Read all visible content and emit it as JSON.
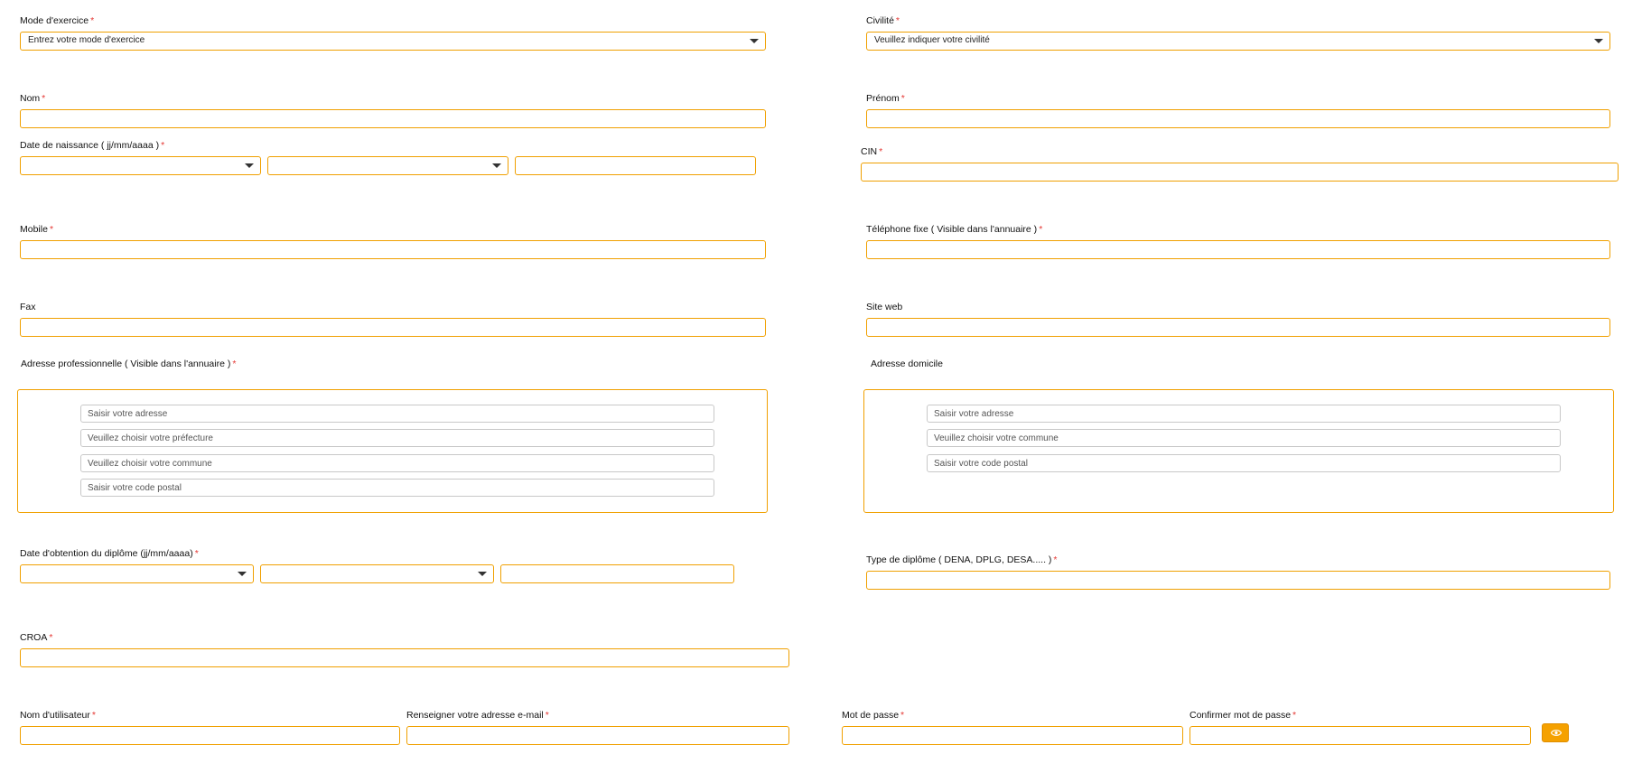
{
  "colors": {
    "accent": "#f0a000",
    "required": "#e53935",
    "button": "#f5a100"
  },
  "required_marker": "*",
  "mode_exercice": {
    "label": "Mode d'exercice",
    "value": "Entrez votre mode d'exercice"
  },
  "civilite": {
    "label": "Civilité",
    "value": "Veuillez indiquer votre civilité"
  },
  "nom": {
    "label": "Nom"
  },
  "prenom": {
    "label": "Prénom"
  },
  "date_naissance": {
    "label": "Date de naissance ( jj/mm/aaaa )"
  },
  "cin": {
    "label": "CIN"
  },
  "mobile": {
    "label": "Mobile"
  },
  "telephone_fixe": {
    "label": "Téléphone fixe ( Visible dans l'annuaire )"
  },
  "fax": {
    "label": "Fax"
  },
  "site_web": {
    "label": "Site web"
  },
  "adresse_pro": {
    "label": "Adresse professionnelle ( Visible dans l'annuaire )",
    "adresse_placeholder": "Saisir votre adresse",
    "prefecture_placeholder": "Veuillez choisir votre préfecture",
    "commune_placeholder": "Veuillez choisir votre commune",
    "code_postal_placeholder": "Saisir votre code postal"
  },
  "adresse_domicile": {
    "label": "Adresse domicile",
    "adresse_placeholder": "Saisir votre adresse",
    "commune_placeholder": "Veuillez choisir votre commune",
    "code_postal_placeholder": "Saisir votre code postal"
  },
  "date_diplome": {
    "label": "Date d'obtention du diplôme (jj/mm/aaaa)"
  },
  "type_diplome": {
    "label": "Type de diplôme ( DENA, DPLG, DESA..... )"
  },
  "croa": {
    "label": "CROA"
  },
  "nom_utilisateur": {
    "label": "Nom d'utilisateur"
  },
  "email": {
    "label": "Renseigner votre adresse e-mail"
  },
  "mot_de_passe": {
    "label": "Mot de passe"
  },
  "confirmer_mot_de_passe": {
    "label": "Confirmer mot de passe"
  },
  "icons": {
    "password_toggle": "eye-icon",
    "select_caret": "caret-down-icon"
  }
}
